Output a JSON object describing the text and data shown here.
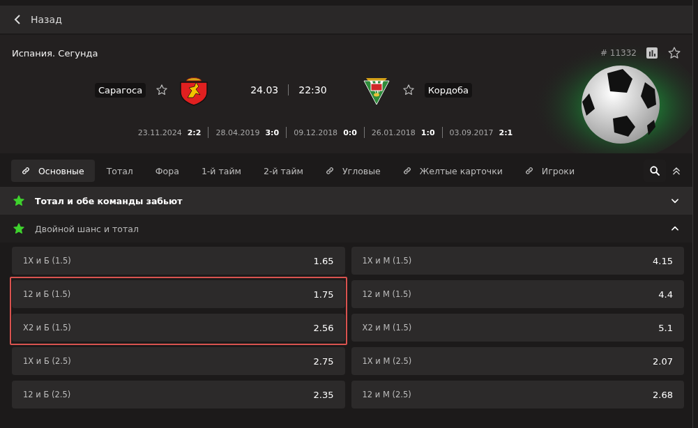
{
  "back": {
    "label": "Назад"
  },
  "match": {
    "league": "Испания. Сегунда",
    "event_id": "# 11332",
    "home": {
      "name": "Сарагоса",
      "favorite": false
    },
    "away": {
      "name": "Кордоба",
      "favorite": false
    },
    "date": "24.03",
    "time": "22:30",
    "history": [
      {
        "date": "23.11.2024",
        "score": "2:2"
      },
      {
        "date": "28.04.2019",
        "score": "3:0"
      },
      {
        "date": "09.12.2018",
        "score": "0:0"
      },
      {
        "date": "26.01.2018",
        "score": "1:0"
      },
      {
        "date": "03.09.2017",
        "score": "2:1"
      }
    ]
  },
  "tabs": [
    {
      "label": "Основные",
      "kind": "link",
      "selected": true
    },
    {
      "label": "Тотал",
      "kind": "plain",
      "selected": false
    },
    {
      "label": "Фора",
      "kind": "plain",
      "selected": false
    },
    {
      "label": "1-й тайм",
      "kind": "plain",
      "selected": false
    },
    {
      "label": "2-й тайм",
      "kind": "plain",
      "selected": false
    },
    {
      "label": "Угловые",
      "kind": "link",
      "selected": false
    },
    {
      "label": "Желтые карточки",
      "kind": "link",
      "selected": false
    },
    {
      "label": "Игроки",
      "kind": "link",
      "selected": false
    }
  ],
  "sections": [
    {
      "title": "Тотал и обе команды забьют",
      "expanded": false
    },
    {
      "title": "Двойной шанс и тотал",
      "expanded": true,
      "columns": [
        [
          {
            "label": "1Х и Б (1.5)",
            "odds": "1.65",
            "selected": false
          },
          {
            "label": "12 и Б (1.5)",
            "odds": "1.75",
            "selected": true
          },
          {
            "label": "Х2 и Б (1.5)",
            "odds": "2.56",
            "selected": true
          },
          {
            "label": "1Х и Б (2.5)",
            "odds": "2.75",
            "selected": false
          },
          {
            "label": "12 и Б (2.5)",
            "odds": "2.35",
            "selected": false
          }
        ],
        [
          {
            "label": "1Х и М (1.5)",
            "odds": "4.15",
            "selected": false
          },
          {
            "label": "12 и М (1.5)",
            "odds": "4.4",
            "selected": false
          },
          {
            "label": "Х2 и М (1.5)",
            "odds": "5.1",
            "selected": false
          },
          {
            "label": "1Х и М (2.5)",
            "odds": "2.07",
            "selected": false
          },
          {
            "label": "12 и М (2.5)",
            "odds": "2.68",
            "selected": false
          }
        ]
      ]
    }
  ]
}
